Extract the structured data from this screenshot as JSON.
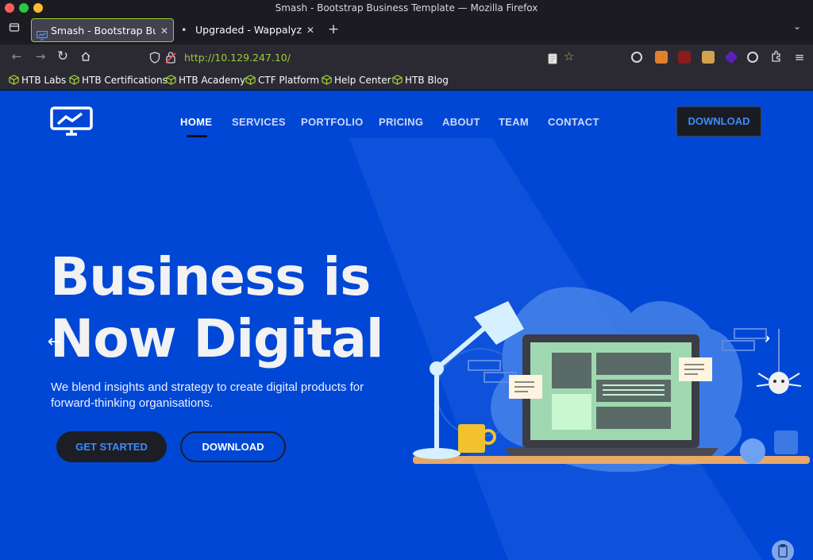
{
  "window": {
    "title": "Smash - Bootstrap Business Template — Mozilla Firefox"
  },
  "tabs": [
    {
      "label": "Smash - Bootstrap Business Template",
      "active": true
    },
    {
      "label": "Upgraded - Wappalyzer",
      "active": false
    }
  ],
  "address_bar": {
    "url": "http://10.129.247.10/"
  },
  "bookmarks": [
    {
      "label": "HTB Labs"
    },
    {
      "label": "HTB Certifications"
    },
    {
      "label": "HTB Academy"
    },
    {
      "label": "CTF Platform"
    },
    {
      "label": "Help Center"
    },
    {
      "label": "HTB Blog"
    }
  ],
  "site": {
    "nav": [
      {
        "label": "HOME",
        "active": true
      },
      {
        "label": "SERVICES"
      },
      {
        "label": "PORTFOLIO"
      },
      {
        "label": "PRICING"
      },
      {
        "label": "ABOUT"
      },
      {
        "label": "TEAM"
      },
      {
        "label": "CONTACT"
      }
    ],
    "header_cta": "DOWNLOAD",
    "hero": {
      "title_line1": "Business is",
      "title_line2": "Now Digital",
      "subtitle": "We blend insights and strategy to create digital products for forward-thinking organisations.",
      "primary_cta": "GET STARTED",
      "secondary_cta": "DOWNLOAD"
    },
    "colors": {
      "hero_bg": "#0047d6",
      "accent_blue": "#3d8bff",
      "dark_button": "#1d1e25",
      "htb_green": "#9acd32"
    }
  },
  "icons": {
    "prev_arrow": "←",
    "next_arrow": "→",
    "tab_close": "✕",
    "new_tab": "+",
    "back": "←",
    "forward": "→",
    "reload": "↻"
  }
}
